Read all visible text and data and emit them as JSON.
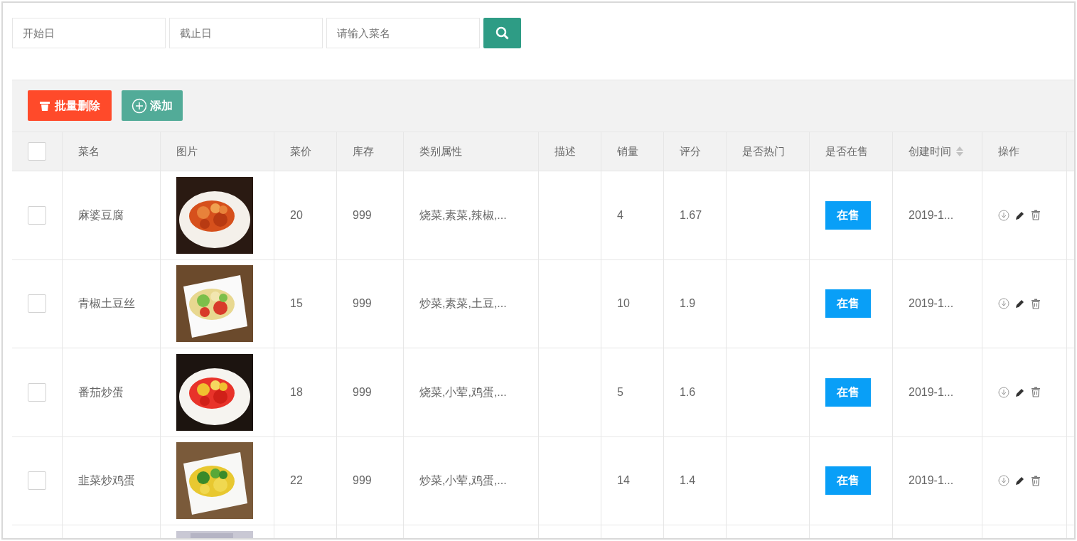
{
  "filters": [
    {
      "placeholder": "开始日"
    },
    {
      "placeholder": "截止日"
    },
    {
      "placeholder": "请输入菜名"
    }
  ],
  "toolbar": [
    {
      "kind": "delete",
      "label": "批量删除"
    },
    {
      "kind": "add",
      "label": "添加"
    }
  ],
  "table": {
    "select_all": {
      "checked": false
    },
    "columns": [
      {
        "label": "菜名",
        "sortable": false
      },
      {
        "label": "图片",
        "sortable": false
      },
      {
        "label": "菜价",
        "sortable": false
      },
      {
        "label": "库存",
        "sortable": false
      },
      {
        "label": "类别属性",
        "sortable": false
      },
      {
        "label": "描述",
        "sortable": false
      },
      {
        "label": "销量",
        "sortable": false
      },
      {
        "label": "评分",
        "sortable": false
      },
      {
        "label": "是否热门",
        "sortable": false
      },
      {
        "label": "是否在售",
        "sortable": false
      },
      {
        "label": "创建时间",
        "sortable": true
      },
      {
        "label": "操作",
        "sortable": false
      }
    ],
    "rows": [
      {
        "checked": false,
        "name": "麻婆豆腐",
        "price": "20",
        "stock": "999",
        "category": "烧菜,素菜,辣椒,...",
        "sales": "4",
        "rating": "1.67",
        "status": "在售",
        "created": "2019-1..."
      },
      {
        "checked": false,
        "name": "青椒土豆丝",
        "price": "15",
        "stock": "999",
        "category": "炒菜,素菜,土豆,...",
        "sales": "10",
        "rating": "1.9",
        "status": "在售",
        "created": "2019-1..."
      },
      {
        "checked": false,
        "name": "番茄炒蛋",
        "price": "18",
        "stock": "999",
        "category": "烧菜,小荤,鸡蛋,...",
        "sales": "5",
        "rating": "1.6",
        "status": "在售",
        "created": "2019-1..."
      },
      {
        "checked": false,
        "name": "韭菜炒鸡蛋",
        "price": "22",
        "stock": "999",
        "category": "炒菜,小荤,鸡蛋,...",
        "sales": "14",
        "rating": "1.4",
        "status": "在售",
        "created": "2019-1..."
      }
    ]
  }
}
